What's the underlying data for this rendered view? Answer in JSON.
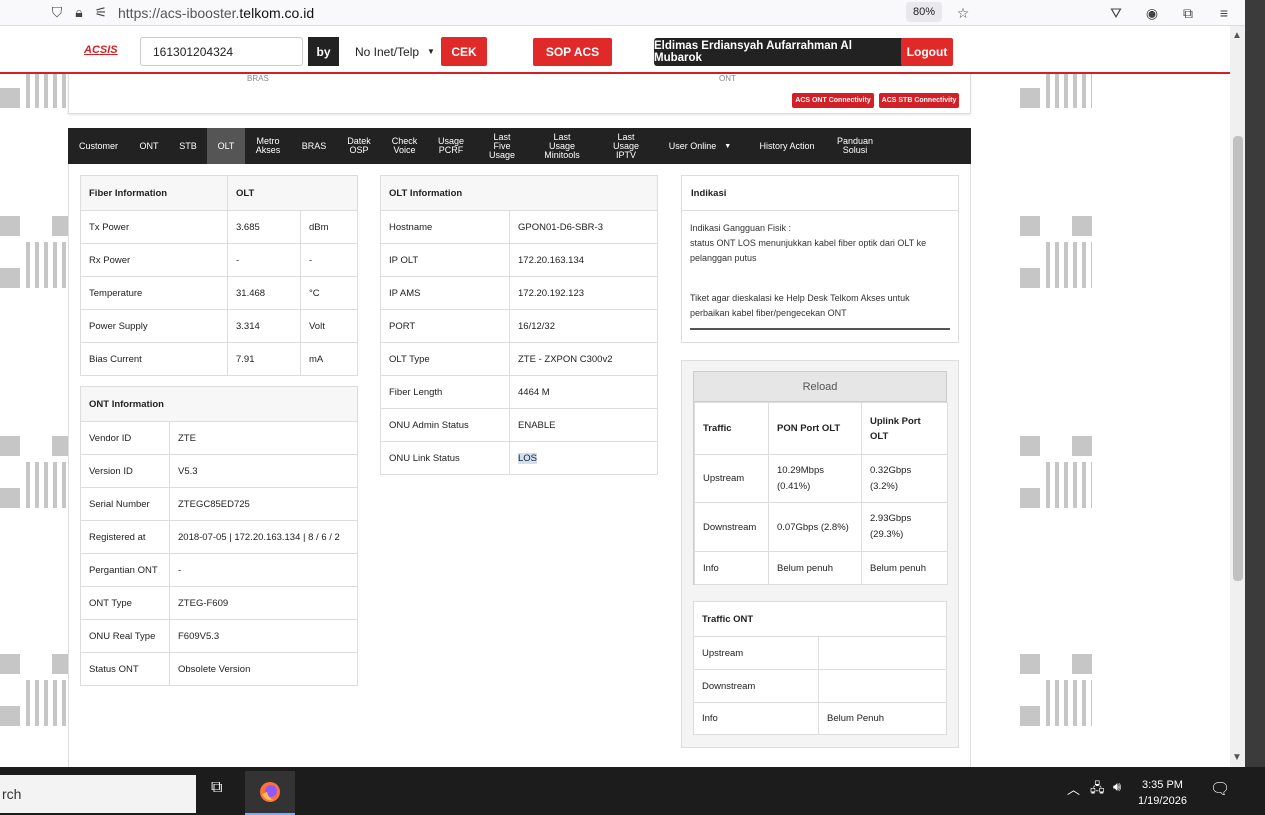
{
  "browser": {
    "url_prefix": "https://acs-ibooster.",
    "url_domain": "telkom.co.id",
    "zoom": "80%"
  },
  "header": {
    "logo": "ACSIS",
    "search_value": "161301204324",
    "by_label": "by",
    "select_value": "No Inet/Telp",
    "cek_label": "CEK",
    "sop_label": "SOP ACS",
    "user_name": "Eldimas Erdiansyah Aufarrahman Al Mubarok",
    "logout_label": "Logout"
  },
  "card": {
    "ghost_bras": "BRAS",
    "ghost_ont": "ONT",
    "badge_ont": "ACS ONT Connectivity",
    "badge_stb": "ACS STB Connectivity"
  },
  "nav": [
    {
      "l1": "Customer",
      "l2": ""
    },
    {
      "l1": "ONT",
      "l2": ""
    },
    {
      "l1": "STB",
      "l2": ""
    },
    {
      "l1": "OLT",
      "l2": ""
    },
    {
      "l1": "Metro",
      "l2": "Akses"
    },
    {
      "l1": "BRAS",
      "l2": ""
    },
    {
      "l1": "Datek",
      "l2": "OSP"
    },
    {
      "l1": "Check",
      "l2": "Voice"
    },
    {
      "l1": "Usage",
      "l2": "PCRF"
    },
    {
      "l1": "Last Five",
      "l2": "Usage"
    },
    {
      "l1": "Last Usage",
      "l2": "Minitools"
    },
    {
      "l1": "Last Usage",
      "l2": "IPTV"
    },
    {
      "l1": "User Online",
      "l2": ""
    },
    {
      "l1": "History Action",
      "l2": ""
    },
    {
      "l1": "Panduan",
      "l2": "Solusi"
    }
  ],
  "fiber": {
    "header": [
      "Fiber Information",
      "OLT"
    ],
    "rows": [
      [
        "Tx Power",
        "3.685",
        "dBm"
      ],
      [
        "Rx Power",
        "-",
        "-"
      ],
      [
        "Temperature",
        "31.468",
        "°C"
      ],
      [
        "Power Supply",
        "3.314",
        "Volt"
      ],
      [
        "Bias Current",
        "7.91",
        "mA"
      ]
    ]
  },
  "ont": {
    "header": "ONT Information",
    "rows": [
      [
        "Vendor ID",
        "ZTE"
      ],
      [
        "Version ID",
        "V5.3"
      ],
      [
        "Serial Number",
        "ZTEGC85ED725"
      ],
      [
        "Registered at",
        "2018-07-05 | 172.20.163.134 | 8 / 6 / 2"
      ],
      [
        "Pergantian ONT",
        "-"
      ],
      [
        "ONT Type",
        "ZTEG-F609"
      ],
      [
        "ONU Real Type",
        "F609V5.3"
      ],
      [
        "Status ONT",
        "Obsolete Version"
      ]
    ]
  },
  "olt": {
    "header": "OLT Information",
    "rows": [
      [
        "Hostname",
        "GPON01-D6-SBR-3"
      ],
      [
        "IP OLT",
        "172.20.163.134"
      ],
      [
        "IP AMS",
        "172.20.192.123"
      ],
      [
        "PORT",
        "16/12/32"
      ],
      [
        "OLT Type",
        "ZTE - ZXPON C300v2"
      ],
      [
        "Fiber Length",
        "4464 M"
      ],
      [
        "ONU Admin Status",
        "ENABLE"
      ],
      [
        "ONU Link Status",
        "LOS"
      ]
    ]
  },
  "indikasi": {
    "header": "Indikasi",
    "line1": "Indikasi Gangguan Fisik :",
    "line2": "status ONT LOS menunjukkan kabel fiber optik dari OLT ke pelanggan putus",
    "line3": "Tiket agar dieskalasi ke Help Desk Telkom Akses untuk perbaikan kabel fiber/pengecekan ONT"
  },
  "traffic": {
    "reload_label": "Reload",
    "header": [
      "Traffic",
      "PON Port OLT",
      "Uplink Port OLT"
    ],
    "rows": [
      [
        "Upstream",
        "10.29Mbps (0.41%)",
        "0.32Gbps (3.2%)"
      ],
      [
        "Downstream",
        "0.07Gbps (2.8%)",
        "2.93Gbps (29.3%)"
      ],
      [
        "Info",
        "Belum penuh",
        "Belum penuh"
      ]
    ]
  },
  "traffic_ont": {
    "header": "Traffic ONT",
    "rows": [
      [
        "Upstream",
        ""
      ],
      [
        "Downstream",
        ""
      ],
      [
        "Info",
        "Belum Penuh"
      ]
    ]
  },
  "taskbar": {
    "search": "rch",
    "time": "3:35 PM",
    "date": "1/19/2026"
  }
}
